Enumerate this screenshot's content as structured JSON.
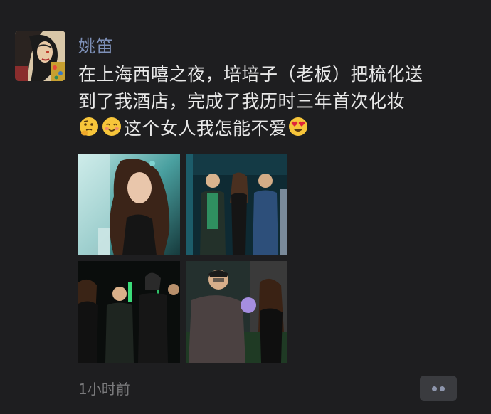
{
  "post": {
    "author_name": "姚笛",
    "text_line1": "在上海西嘻之夜，培培子（老板）把梳化送",
    "text_line2": "到了我酒店，完成了我历时三年首次化妆",
    "text_line3": "这个女人我怎能不爱",
    "emojis": [
      "thinking-face-icon",
      "smiling-blushing-face-icon",
      "heart-eyes-face-icon"
    ],
    "timestamp": "1小时前",
    "photos": [
      {
        "name": "photo-woman-portrait"
      },
      {
        "name": "photo-group-standing"
      },
      {
        "name": "photo-group-event"
      },
      {
        "name": "photo-man-and-woman"
      }
    ]
  },
  "colors": {
    "background": "#1e1e20",
    "author_name": "#7d90b8",
    "text": "#e8e8e8",
    "timestamp": "#7a7a7c"
  }
}
